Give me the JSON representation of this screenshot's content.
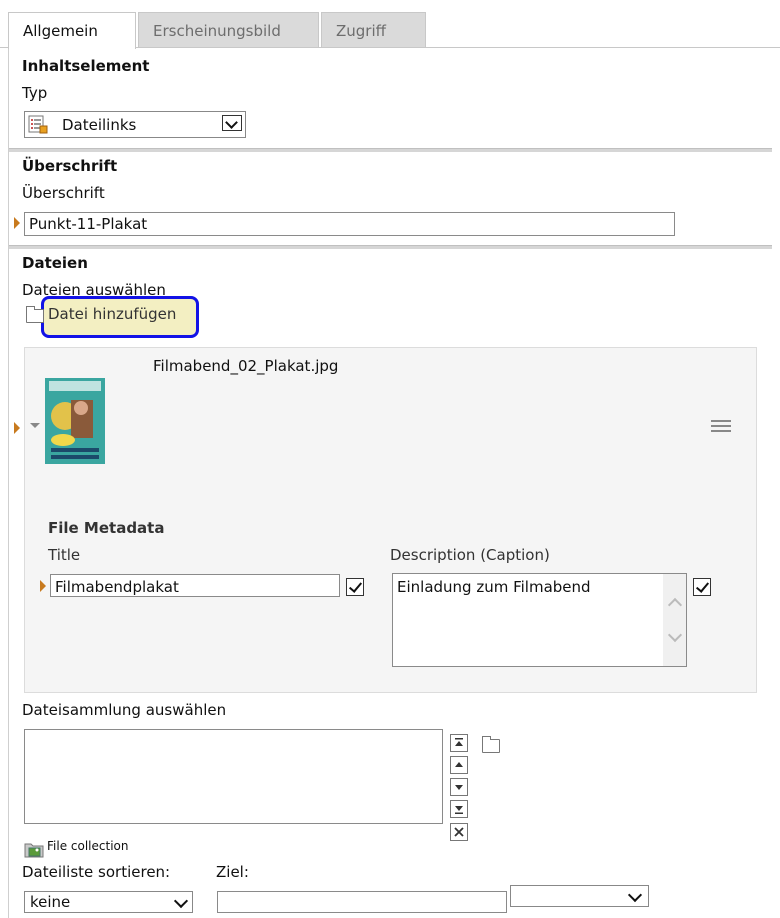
{
  "tabs": [
    {
      "label": "Allgemein",
      "active": true
    },
    {
      "label": "Erscheinungsbild",
      "active": false
    },
    {
      "label": "Zugriff",
      "active": false
    }
  ],
  "content_element": {
    "header": "Inhaltselement",
    "type_label": "Typ",
    "type_value": "Dateilinks"
  },
  "heading_section": {
    "header": "Überschrift",
    "label": "Überschrift",
    "value": "Punkt-11-Plakat"
  },
  "files_section": {
    "header": "Dateien",
    "select_label": "Dateien auswählen",
    "add_file_label": "Datei hinzufügen",
    "highlight_color": "#1212e6",
    "file": {
      "filename": "Filmabend_02_Plakat.jpg",
      "metadata_header": "File Metadata",
      "title_label": "Title",
      "title_value": "Filmabendplakat",
      "description_label": "Description (Caption)",
      "description_value": "Einladung zum Filmabend"
    }
  },
  "collection": {
    "label": "Dateisammlung auswählen",
    "file_collection_label": "File collection"
  },
  "sort": {
    "label": "Dateiliste sortieren:",
    "value": "keine",
    "target_label": "Ziel:",
    "target_value": ""
  },
  "colors": {
    "marker": "#c87a1e",
    "tab_inactive": "#dadada",
    "highlight_fill": "#f3efc2"
  }
}
